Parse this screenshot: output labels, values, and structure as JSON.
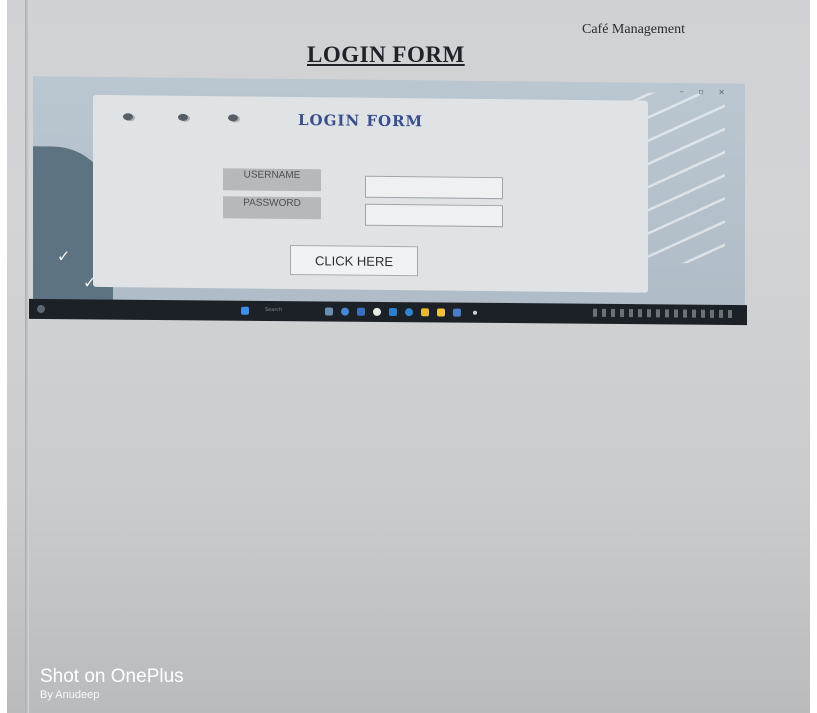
{
  "document": {
    "header": "Café Management",
    "title": "LOGIN FORM"
  },
  "app": {
    "title": "LOGIN FORM",
    "username_label": "USERNAME",
    "password_label": "PASSWORD",
    "username_value": "",
    "password_value": "",
    "submit_label": "CLICK HERE"
  },
  "taskbar": {
    "search_placeholder": "Search",
    "icons": [
      "windows-start-icon",
      "search-icon",
      "file-explorer-icon",
      "edge-icon",
      "mail-icon",
      "chrome-icon",
      "store-icon",
      "folder-icon",
      "settings-icon",
      "arrow-icon"
    ]
  },
  "watermark": {
    "line1": "Shot on OnePlus",
    "line2": "By Anudeep"
  },
  "colors": {
    "panel_title": "#3a4d8c",
    "taskbar": "#1c2127",
    "panel_background": "#dfe3e5"
  }
}
